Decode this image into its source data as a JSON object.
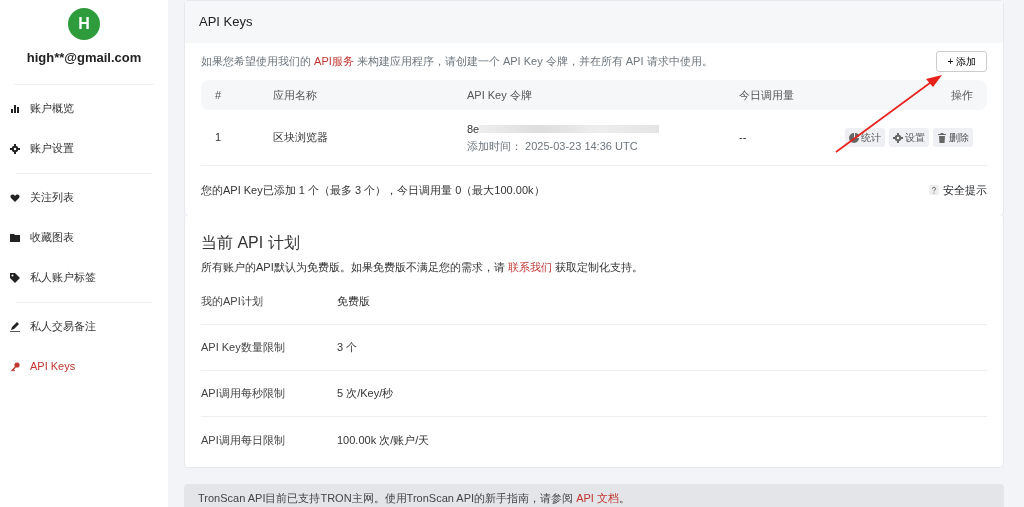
{
  "user": {
    "avatar_letter": "H",
    "email": "high**@gmail.com"
  },
  "sidebar": {
    "groups": [
      [
        {
          "label": "账户概览",
          "kind": "chart",
          "selected": false
        },
        {
          "label": "账户设置",
          "kind": "gear",
          "selected": false
        }
      ],
      [
        {
          "label": "关注列表",
          "kind": "heart",
          "selected": false
        },
        {
          "label": "收藏图表",
          "kind": "folder",
          "selected": false
        },
        {
          "label": "私人账户标签",
          "kind": "tag",
          "selected": false
        }
      ],
      [
        {
          "label": "私人交易备注",
          "kind": "pen",
          "selected": false
        },
        {
          "label": "API Keys",
          "kind": "key",
          "selected": true
        }
      ]
    ]
  },
  "card": {
    "title": "API Keys",
    "intro": {
      "before": "如果您希望使用我们的 ",
      "link": "API服务",
      "after": " 来构建应用程序，请创建一个 API Key 令牌，并在所有 API 请求中使用。"
    },
    "add_button": "+ 添加",
    "table": {
      "columns": [
        "#",
        "应用名称",
        "API Key 令牌",
        "今日调用量",
        "操作"
      ],
      "rows": [
        {
          "index": "1",
          "name": "区块浏览器",
          "key_prefix": "8e",
          "added": "添加时间：  2025-03-23 14:36 UTC",
          "usage": "--",
          "actions": [
            {
              "label": "统计",
              "kind": "pie"
            },
            {
              "label": "设置",
              "kind": "gear"
            },
            {
              "label": "删除",
              "kind": "trash"
            }
          ]
        }
      ]
    },
    "summary": "您的API Key已添加 1 个（最多 3 个），今日调用量 0（最大100.00k）",
    "safety_tip": "安全提示"
  },
  "plan": {
    "title": "当前 API 计划",
    "note": {
      "before": "所有账户的API默认为免费版。如果免费版不满足您的需求，请 ",
      "link": "联系我们",
      "after": " 获取定制化支持。"
    },
    "rows": [
      {
        "label": "我的API计划",
        "value": "免费版"
      },
      {
        "label": "API Key数量限制",
        "value": "3 个"
      },
      {
        "label": "API调用每秒限制",
        "value": "5 次/Key/秒"
      },
      {
        "label": "API调用每日限制",
        "value": "100.00k 次/账户/天"
      }
    ]
  },
  "banner": {
    "before": "TronScan API目前已支持TRON主网。使用TronScan API的新手指南，请参阅 ",
    "link": "API 文档",
    "after": "。"
  }
}
